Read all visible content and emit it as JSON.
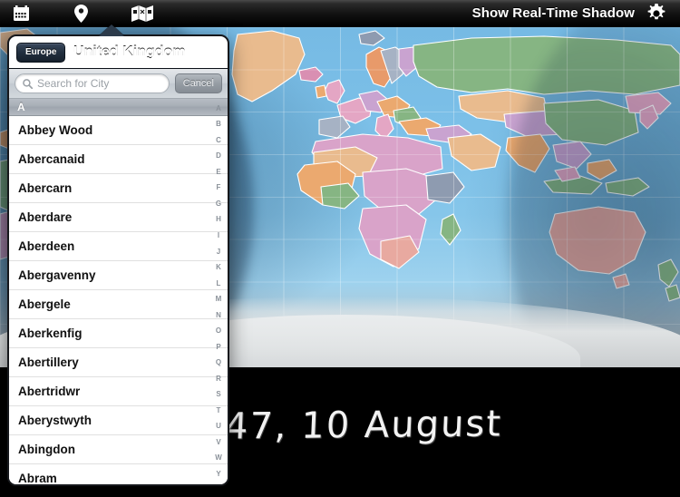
{
  "toolbar": {
    "icons": [
      {
        "name": "calendar-icon",
        "label": "Calendar"
      },
      {
        "name": "location-pin-icon",
        "label": "Location"
      },
      {
        "name": "map-icon",
        "label": "Map",
        "selected": true
      }
    ],
    "title": "Show Real-Time Shadow",
    "settings_icon": "gear-icon"
  },
  "clock": {
    "text": "47, 10 August"
  },
  "popover": {
    "back_button": "Europe",
    "title": "United Kingdom",
    "search": {
      "placeholder": "Search for City",
      "value": "",
      "icon": "search-icon",
      "cancel_label": "Cancel"
    },
    "section_header": "A",
    "cities": [
      "Abbey Wood",
      "Abercanaid",
      "Abercarn",
      "Aberdare",
      "Aberdeen",
      "Abergavenny",
      "Abergele",
      "Aberkenfig",
      "Abertillery",
      "Abertridwr",
      "Aberystwyth",
      "Abingdon",
      "Abram"
    ],
    "alphabet_index": [
      "A",
      "B",
      "C",
      "D",
      "E",
      "F",
      "G",
      "H",
      "I",
      "J",
      "K",
      "L",
      "M",
      "N",
      "O",
      "P",
      "Q",
      "R",
      "S",
      "T",
      "U",
      "V",
      "W",
      "Y"
    ]
  },
  "colors": {
    "ocean": "#86c6ea",
    "toolbar_bg": "#000000",
    "navbar_bg": "#1d2938",
    "accent": "#2b3b4e",
    "ice": "#dfe2e3",
    "background": "#000000"
  }
}
